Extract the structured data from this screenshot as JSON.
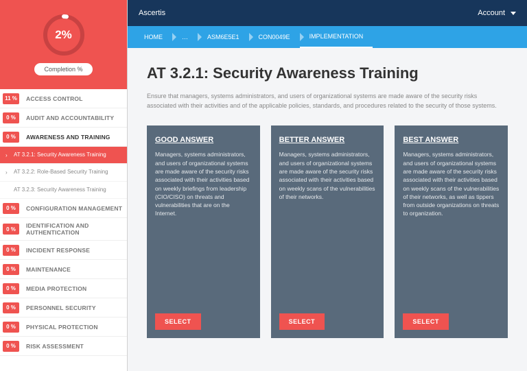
{
  "colors": {
    "accent": "#ef5350",
    "topbar": "#17365b",
    "crumb": "#2ea3e6",
    "card": "#596a7b"
  },
  "header": {
    "brand": "Ascertis",
    "account": "Account"
  },
  "progress": {
    "percent": "2%",
    "label": "Completion %"
  },
  "sidebar": {
    "cats": [
      {
        "badge": "11 %",
        "label": "ACCESS CONTROL"
      },
      {
        "badge": "0 %",
        "label": "AUDIT AND ACCOUNTABILITY"
      },
      {
        "badge": "0 %",
        "label": "AWARENESS AND TRAINING"
      },
      {
        "badge": "0 %",
        "label": "CONFIGURATION MANAGEMENT"
      },
      {
        "badge": "0 %",
        "label": "IDENTIFICATION AND AUTHENTICATION"
      },
      {
        "badge": "0 %",
        "label": "INCIDENT RESPONSE"
      },
      {
        "badge": "0 %",
        "label": "MAINTENANCE"
      },
      {
        "badge": "0 %",
        "label": "MEDIA PROTECTION"
      },
      {
        "badge": "0 %",
        "label": "PERSONNEL SECURITY"
      },
      {
        "badge": "0 %",
        "label": "PHYSICAL PROTECTION"
      },
      {
        "badge": "0 %",
        "label": "RISK ASSESSMENT"
      }
    ],
    "subs": [
      {
        "label": "AT 3.2.1: Security Awareness Training",
        "selected": true
      },
      {
        "label": "AT 3.2.2: Role-Based Security Training",
        "selected": false
      },
      {
        "label": "AT 3.2.3: Security Awareness Training",
        "selected": false
      }
    ]
  },
  "crumbs": [
    "HOME",
    "…",
    "ASM6E5E1",
    "CON0049E",
    "IMPLEMENTATION"
  ],
  "page": {
    "title": "AT 3.2.1: Security Awareness Training",
    "subtitle": "Ensure that managers, systems administrators, and users of organizational systems are made aware of the security risks associated with their activities and of the applicable policies, standards, and procedures related to the security of those systems."
  },
  "cards": [
    {
      "title": "GOOD ANSWER",
      "body": "Managers, systems administrators, and users of organizational systems are made aware of the security risks associated with their activities based on weekly briefings from leadership (CIO/CISO) on threats and vulnerabilities that are on the Internet.",
      "btn": "SELECT"
    },
    {
      "title": "BETTER ANSWER",
      "body": "Managers, systems administrators, and users of organizational systems are made aware of the security risks associated with their activities based on weekly scans of the vulnerabilities of their networks.",
      "btn": "SELECT"
    },
    {
      "title": "BEST ANSWER",
      "body": "Managers, systems administrators, and users of organizational systems are made aware of the security risks associated with their activities based on weekly scans of the vulnerabilities of their networks, as well as tippers from outside organizations on threats to organization.",
      "btn": "SELECT"
    }
  ]
}
